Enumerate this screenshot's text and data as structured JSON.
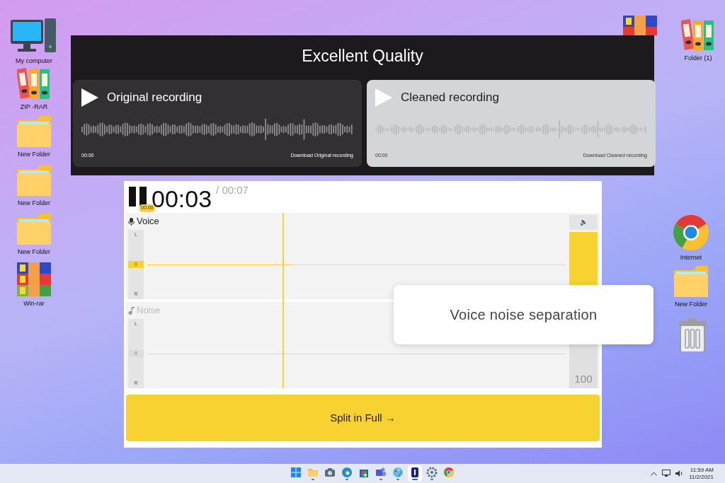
{
  "desktop_left": [
    {
      "kind": "computer",
      "label": "My computer"
    },
    {
      "kind": "binders",
      "label": "ZIP -RAR"
    },
    {
      "kind": "folder",
      "label": "New Folder"
    },
    {
      "kind": "folder",
      "label": "New Folder"
    },
    {
      "kind": "folder",
      "label": "New Folder"
    },
    {
      "kind": "archive",
      "label": "Win-rar"
    }
  ],
  "desktop_right": [
    {
      "kind": "binders",
      "label": "Folder (1)"
    },
    {
      "kind": "browser",
      "label": "Internet"
    },
    {
      "kind": "folder",
      "label": "New Folder"
    },
    {
      "kind": "trash"
    }
  ],
  "quality_window": {
    "title": "Excellent Quality",
    "recordings": [
      {
        "title": "Original recording",
        "time": "00:00",
        "download": "Download Original recording",
        "selected": false
      },
      {
        "title": "Cleaned recording",
        "time": "00:00",
        "download": "Download Cleaned recording",
        "selected": true
      }
    ]
  },
  "editor": {
    "current_time": "00:03",
    "total_time": "/ 00:07",
    "badge": "00:00",
    "playhead": {
      "level": 0.33
    },
    "tracks": [
      {
        "kind": "voice",
        "name": "Voice",
        "enabled": true,
        "meter_labels": [
          "L",
          "0",
          "R"
        ]
      },
      {
        "kind": "noise",
        "name": "Noise",
        "enabled": false,
        "meter_labels": [
          "L",
          "0",
          "R"
        ],
        "reading": "100"
      }
    ],
    "mute_button": "🔈",
    "split_button": "Split in Full →"
  },
  "popup": {
    "text": "Voice noise separation"
  },
  "taskbar": {
    "apps": [
      {
        "kind": "start",
        "selected": false,
        "running": false
      },
      {
        "kind": "explorer",
        "selected": false,
        "running": true
      },
      {
        "kind": "camera",
        "selected": false,
        "running": false
      },
      {
        "kind": "edge",
        "selected": false,
        "running": true
      },
      {
        "kind": "store",
        "selected": false,
        "running": false
      },
      {
        "kind": "teams",
        "selected": false,
        "running": true
      },
      {
        "kind": "paint",
        "selected": false,
        "running": true
      },
      {
        "kind": "app",
        "selected": true,
        "running": true
      },
      {
        "kind": "settings",
        "selected": false,
        "running": true
      },
      {
        "kind": "chrome",
        "selected": false,
        "running": false
      }
    ],
    "time": "11:59 AM",
    "date": "11/2/2021"
  }
}
